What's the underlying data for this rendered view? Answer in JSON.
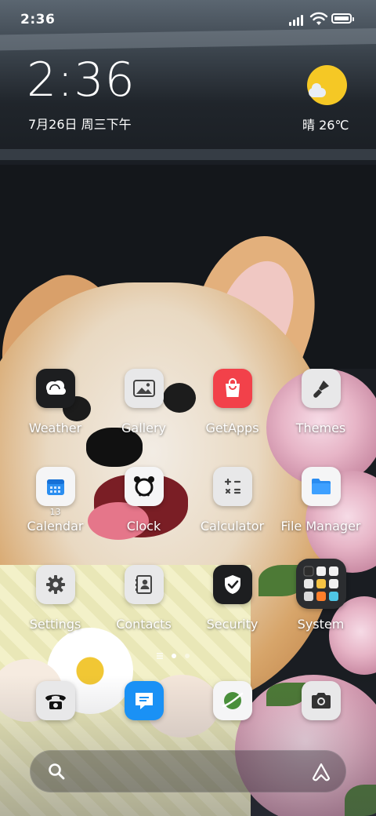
{
  "status_bar": {
    "time": "2:36",
    "icons": [
      "signal-icon",
      "wifi-icon",
      "battery-icon"
    ]
  },
  "clock_widget": {
    "time": "2:36",
    "date": "7月26日 周三下午"
  },
  "weather_widget": {
    "icon": "sunny-partly-cloudy-icon",
    "text": "晴 26℃"
  },
  "apps": [
    {
      "label": "Weather",
      "icon": "weather-icon"
    },
    {
      "label": "Gallery",
      "icon": "gallery-icon"
    },
    {
      "label": "GetApps",
      "icon": "getapps-icon"
    },
    {
      "label": "Themes",
      "icon": "themes-icon"
    },
    {
      "label": "Calendar",
      "icon": "calendar-icon",
      "badge": "13"
    },
    {
      "label": "Clock",
      "icon": "clock-icon"
    },
    {
      "label": "Calculator",
      "icon": "calculator-icon"
    },
    {
      "label": "File Manager",
      "icon": "file-manager-icon"
    },
    {
      "label": "Settings",
      "icon": "settings-icon"
    },
    {
      "label": "Contacts",
      "icon": "contacts-icon"
    },
    {
      "label": "Security",
      "icon": "security-icon"
    },
    {
      "label": "System",
      "icon": "system-folder-icon"
    }
  ],
  "dock": [
    {
      "icon": "phone-icon"
    },
    {
      "icon": "messages-icon"
    },
    {
      "icon": "browser-icon"
    },
    {
      "icon": "camera-icon"
    }
  ],
  "page_indicator": {
    "pages": 2,
    "current": 1
  },
  "search_bar": {
    "left_icon": "search-icon",
    "right_icon": "assistant-icon"
  }
}
